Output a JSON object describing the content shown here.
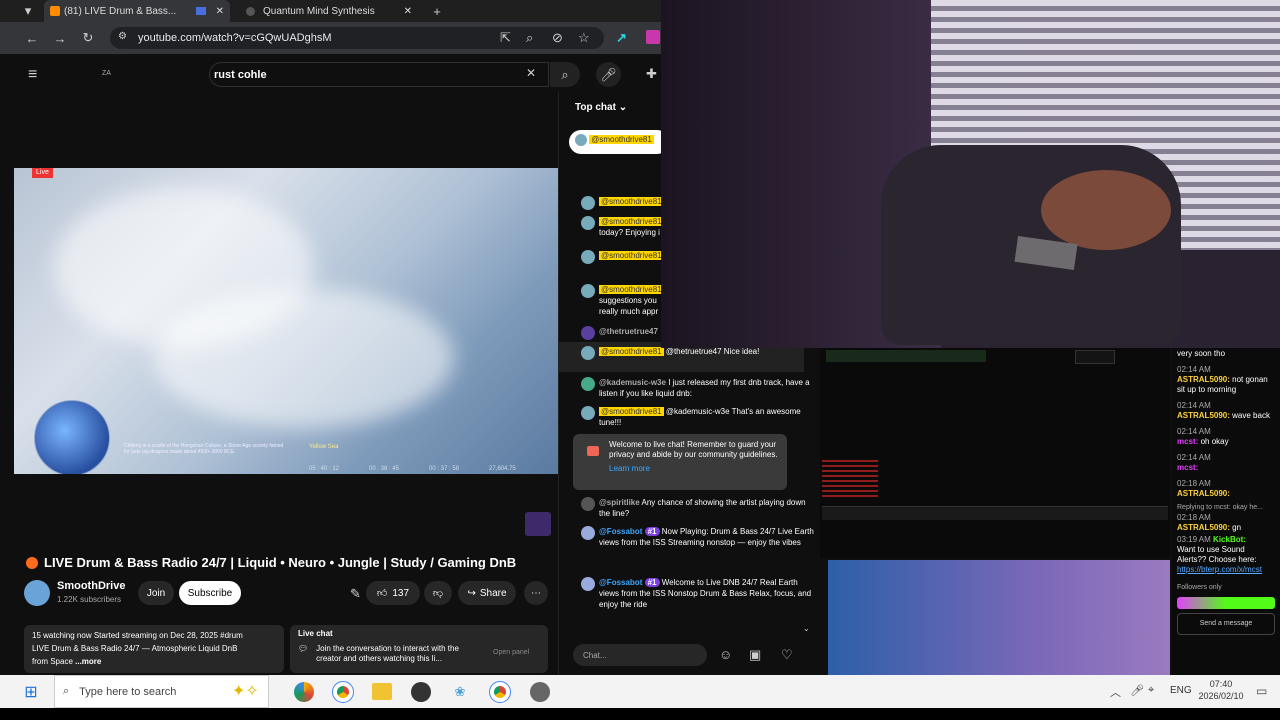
{
  "browser": {
    "tabs": [
      {
        "label": "(81) LIVE Drum & Bass...",
        "active": true
      },
      {
        "label": "Quantum Mind Synthesis",
        "active": false
      }
    ],
    "url": "youtube.com/watch?v=cGQwUADghsM"
  },
  "youtube": {
    "country": "ZA",
    "search_value": "rust cohle",
    "live_badge": "Live",
    "video_overlay": {
      "caption": "Chifeng is a cradle of the Hongshan Culture, a Stone Age society famed for jade pig-dragons made about 4500–3000 BCE",
      "place": "Yellow Sea",
      "stats": [
        "05 : 40 : 12",
        "00 : 38 : 45",
        "00 : 37 : 58",
        "27,604.75"
      ]
    },
    "title": "LIVE Drum & Bass Radio 24/7 | Liquid • Neuro • Jungle | Study / Gaming DnB",
    "channel": "SmoothDrive",
    "subscribers": "1.22K subscribers",
    "join_label": "Join",
    "subscribe_label": "Subscribe",
    "likes": "137",
    "share_label": "Share",
    "description": {
      "line1": "15 watching now  Started streaming on Dec 28, 2025  #drum",
      "line2": "LIVE Drum & Bass Radio 24/7 — Atmospheric Liquid DnB",
      "line3": "from Space",
      "more": "...more"
    },
    "livechat_card": {
      "title": "Live chat",
      "text": "Join the conversation to interact with the creator and others watching this li...",
      "button": "Open panel"
    }
  },
  "chat": {
    "header": "Top chat",
    "pinned_name": "@smoothdrive81",
    "messages": [
      {
        "name": "@smoothdrive81",
        "text": ""
      },
      {
        "name": "@smoothdrive81",
        "text": "today? Enjoying i"
      },
      {
        "name": "@smoothdrive81",
        "text": ""
      },
      {
        "name": "@smoothdrive81",
        "text": "suggestions you really much appr"
      },
      {
        "name": "@thetruetrue47",
        "text": ""
      },
      {
        "name": "@smoothdrive81",
        "text": "@thetruetrue47 Nice idea!"
      },
      {
        "name": "@kademusic-w3e",
        "text": "I just released my first dnb track, have a listen if you like liquid dnb:"
      },
      {
        "name": "@smoothdrive81",
        "text": "@kademusic-w3e That's an awesome tune!!!"
      }
    ],
    "welcome": "Welcome to live chat! Remember to guard your privacy and abide by our community guidelines.",
    "learn_more": "Learn more",
    "msg_spirit": {
      "name": "@spiritlike",
      "text": "Any chance of showing the artist playing down the line?"
    },
    "msg_fossa1": {
      "name": "@Fossabot",
      "badge": "#1",
      "text": "Now Playing: Drum & Bass 24/7  Live Earth views from the ISS  Streaming nonstop — enjoy the vibes"
    },
    "msg_fossa2": {
      "name": "@Fossabot",
      "badge": "#1",
      "text": "Welcome to Live DNB 24/7 Real Earth views from the ISS  Nonstop Drum & Bass  Relax, focus, and enjoy the ride"
    },
    "input_placeholder": "Chat..."
  },
  "kick": {
    "lines": [
      {
        "time": "",
        "user": "",
        "text": "very soon tho"
      },
      {
        "time": "02:14 AM",
        "user": "ASTRAL5090:",
        "text": "not gonan sit up to morning"
      },
      {
        "time": "02:14 AM",
        "user": "ASTRAL5090:",
        "text": "wave back"
      },
      {
        "time": "02:14 AM",
        "user": "mcst:",
        "text": "oh okay"
      },
      {
        "time": "02:14 AM",
        "user": "mcst:",
        "text": ""
      },
      {
        "time": "02:18 AM",
        "user": "ASTRAL5090:",
        "text": ""
      }
    ],
    "reply": "Replying to mcst: okay he...",
    "after_reply": {
      "time": "02:18 AM",
      "user": "ASTRAL5090:",
      "text": "gn"
    },
    "bot": {
      "time": "03:19 AM",
      "user": "KickBot:",
      "text": "Want to use Sound Alerts?? Choose here:"
    },
    "link": "https://bterp.com/x/mcst",
    "followers": "Followers only",
    "send": "Send a message"
  },
  "taskbar": {
    "search_placeholder": "Type here to search",
    "lang": "ENG",
    "time": "07:40",
    "date": "2026/02/10"
  }
}
